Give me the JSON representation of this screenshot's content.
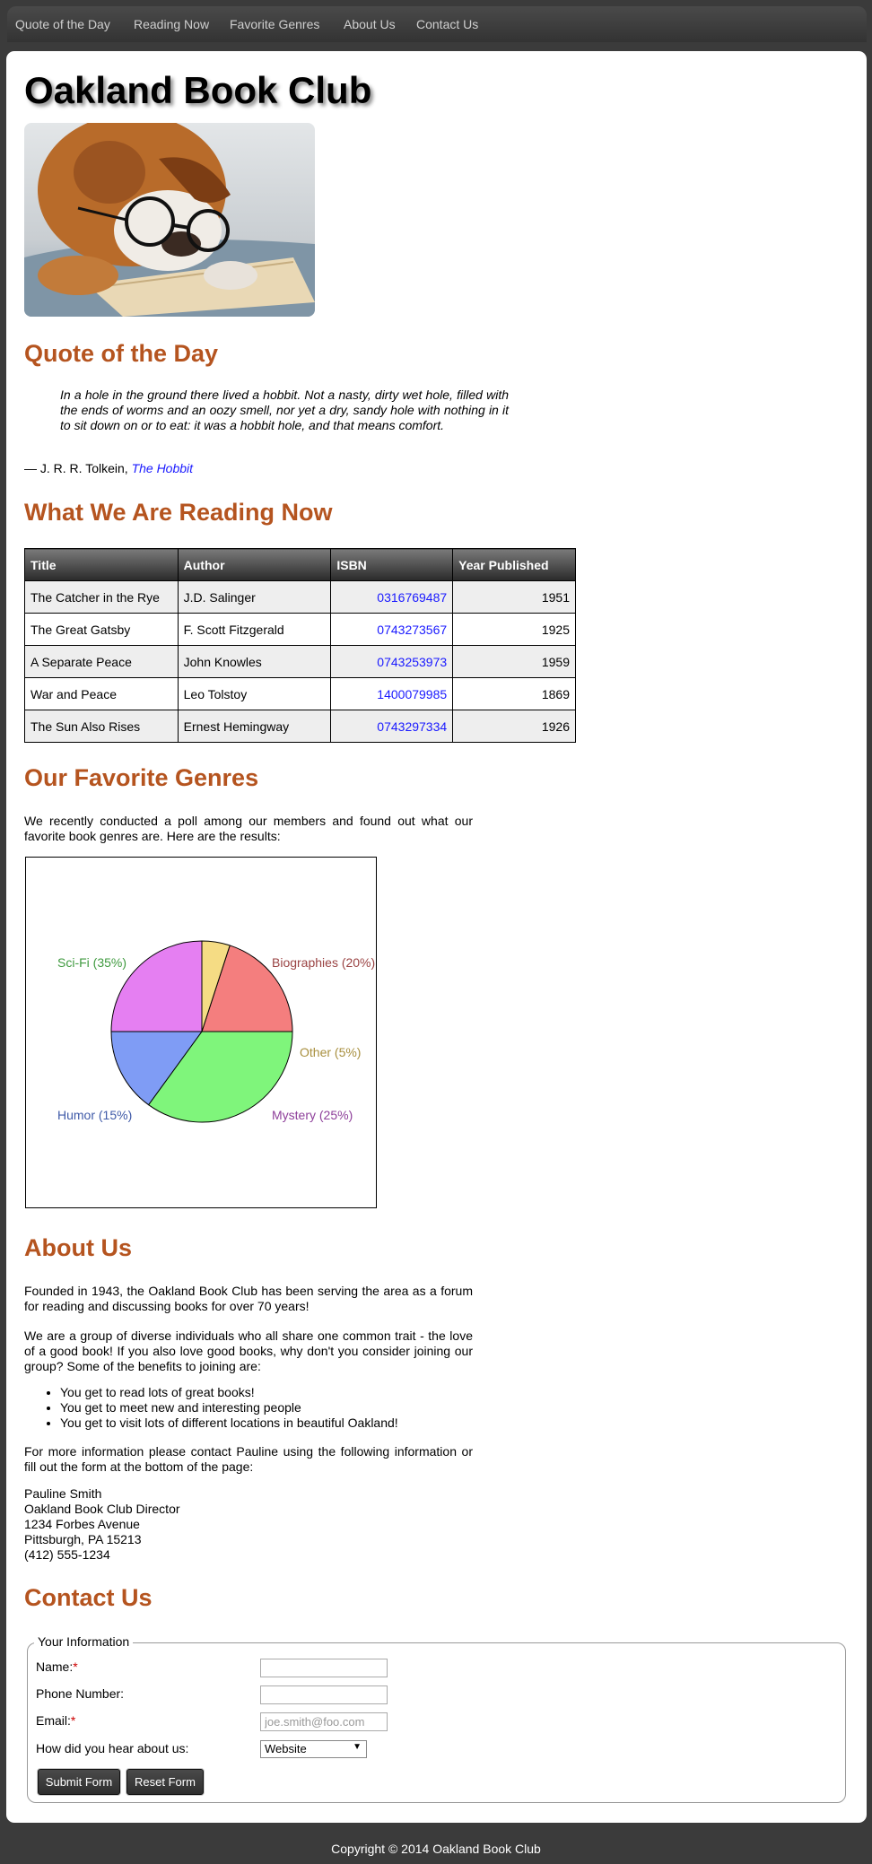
{
  "nav": {
    "items": [
      "Quote of the Day",
      "Reading Now",
      "Favorite Genres",
      "About Us",
      "Contact Us"
    ]
  },
  "header": {
    "title": "Oakland Book Club"
  },
  "quote": {
    "heading": "Quote of the Day",
    "text": "In a hole in the ground there lived a hobbit. Not a nasty, dirty wet hole, filled with the ends of worms and an oozy smell, nor yet a dry, sandy hole with nothing in it to sit down on or to eat: it was a hobbit hole, and that means comfort.",
    "author": "— J. R. R. Tolkein, ",
    "book": "The Hobbit"
  },
  "reading": {
    "heading": "What We Are Reading Now",
    "columns": [
      "Title",
      "Author",
      "ISBN",
      "Year Published"
    ],
    "rows": [
      [
        "The Catcher in the Rye",
        "J.D. Salinger",
        "0316769487",
        "1951"
      ],
      [
        "The Great Gatsby",
        "F. Scott Fitzgerald",
        "0743273567",
        "1925"
      ],
      [
        "A Separate Peace",
        "John Knowles",
        "0743253973",
        "1959"
      ],
      [
        "War and Peace",
        "Leo Tolstoy",
        "1400079985",
        "1869"
      ],
      [
        "The Sun Also Rises",
        "Ernest Hemingway",
        "0743297334",
        "1926"
      ]
    ]
  },
  "genres": {
    "heading": "Our Favorite Genres",
    "intro": "We recently conducted a poll among our members and found out what our favorite book genres are. Here are the results:"
  },
  "chart_data": {
    "type": "pie",
    "slices": [
      {
        "label": "Biographies (20%)",
        "value": 20,
        "color": "#f47e7e",
        "text_color": "#9a4343"
      },
      {
        "label": "Other (5%)",
        "value": 5,
        "color": "#f5dc84",
        "text_color": "#a88f3e"
      },
      {
        "label": "Mystery (25%)",
        "value": 25,
        "color": "#e57ff2",
        "text_color": "#8e3f9a"
      },
      {
        "label": "Humor (15%)",
        "value": 15,
        "color": "#7f9cf5",
        "text_color": "#3f5aa8"
      },
      {
        "label": "Sci-Fi (35%)",
        "value": 35,
        "color": "#7ff57b",
        "text_color": "#3f9a3f"
      }
    ]
  },
  "about": {
    "heading": "About Us",
    "p1": "Founded in 1943, the Oakland Book Club has been serving the area as a forum for reading and discussing books for over 70 years!",
    "p2": "We are a group of diverse individuals who all share one common trait - the love of a good book! If you also love good books, why don't you consider joining our group? Some of the benefits to joining are:",
    "benefits": [
      "You get to read lots of great books!",
      "You get to meet new and interesting people",
      "You get to visit lots of different locations in beautiful Oakland!"
    ],
    "p3": "For more information please contact Pauline using the following information or fill out the form at the bottom of the page:",
    "address": [
      "Pauline Smith",
      "Oakland Book Club Director",
      "1234 Forbes Avenue",
      "Pittsburgh, PA 15213",
      "(412) 555-1234"
    ]
  },
  "contact": {
    "heading": "Contact Us",
    "legend": "Your Information",
    "name_label": "Name:",
    "phone_label": "Phone Number:",
    "email_label": "Email:",
    "required_mark": "*",
    "how_label": "How did you hear about us:",
    "name_value": "",
    "phone_value": "",
    "email_placeholder": "joe.smith@foo.com",
    "how_selected": "Website",
    "submit_label": "Submit Form",
    "reset_label": "Reset Form"
  },
  "footer": {
    "text": "Copyright © 2014 Oakland Book Club"
  }
}
